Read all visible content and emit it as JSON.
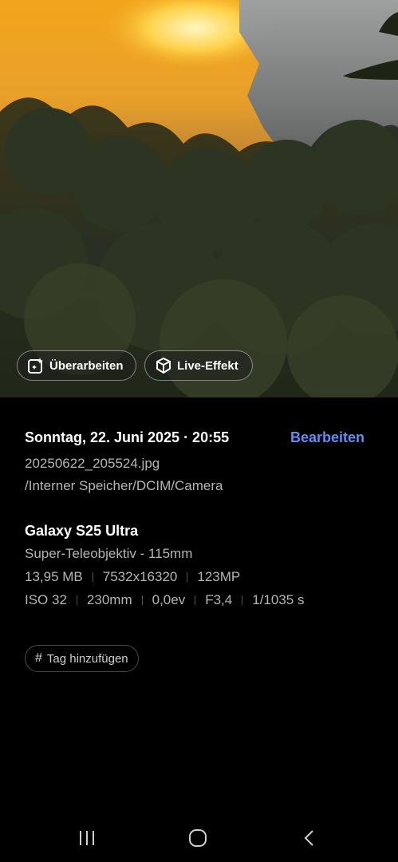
{
  "photo_actions": {
    "edit_label": "Überarbeiten",
    "live_effect_label": "Live-Effekt"
  },
  "details": {
    "datetime": "Sonntag, 22. Juni 2025 · 20:55",
    "edit_link": "Bearbeiten",
    "filename": "20250622_205524.jpg",
    "path": "/Interner Speicher/DCIM/Camera",
    "device": "Galaxy S25 Ultra",
    "lens": "Super-Teleobjektiv - 115mm",
    "file_specs": [
      "13,95 MB",
      "7532x16320",
      "123MP"
    ],
    "exposure_specs": [
      "ISO 32",
      "230mm",
      "0,0ev",
      "F3,4",
      "1/1035 s"
    ]
  },
  "tag": {
    "label": "Tag hinzufügen"
  },
  "colors": {
    "accent": "#5f8ef0",
    "background": "#000000",
    "secondary_text": "#b5b5b5"
  },
  "navbar": {
    "icons": [
      "recent-apps-icon",
      "home-icon",
      "back-icon"
    ]
  }
}
